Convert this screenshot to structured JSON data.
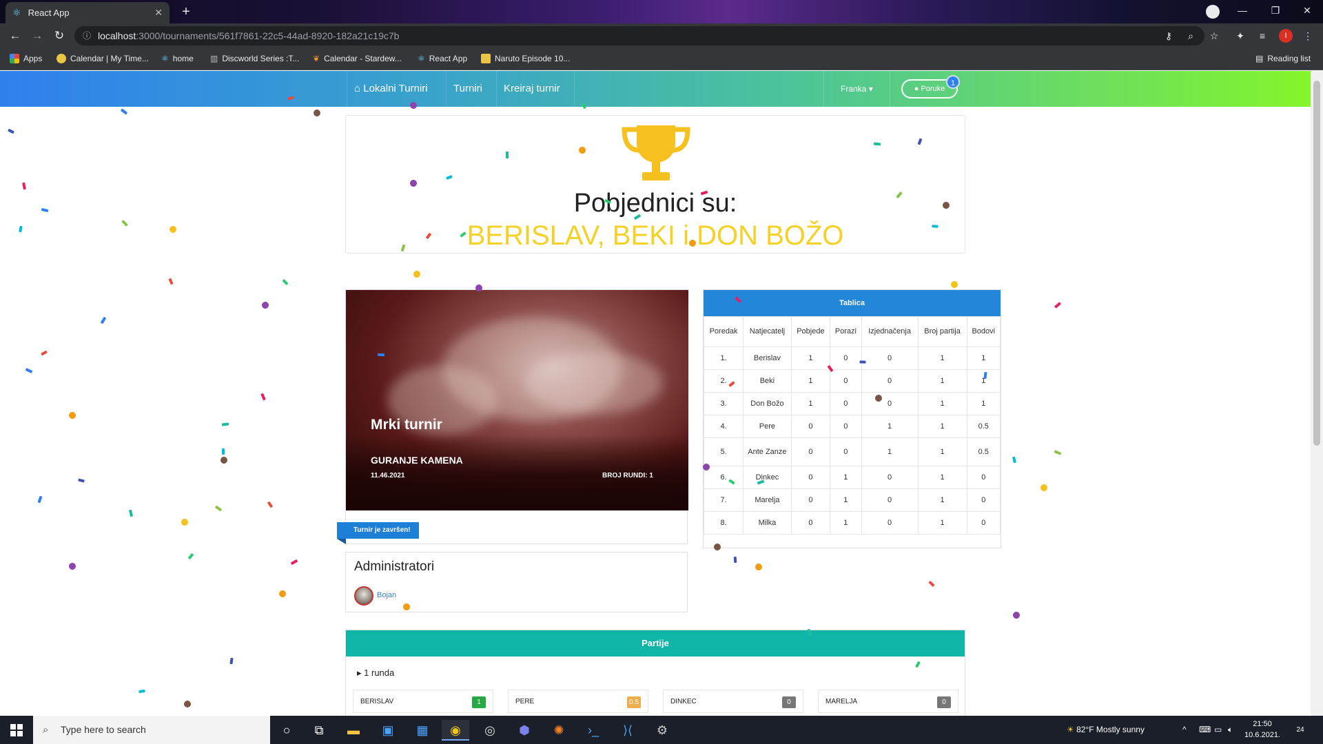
{
  "browser": {
    "tab_title": "React App",
    "new_tab": "+",
    "url_host": "localhost",
    "url_path": ":3000/tournaments/561f7861-22c5-44ad-8920-182a21c19c7b",
    "profile_initial": "I",
    "bookmarks": [
      {
        "label": "Apps",
        "icon": "apps-grid-icon",
        "color": "#ea4335"
      },
      {
        "label": "Calendar | My Time...",
        "icon": "calendar-icon",
        "color": "#e8c547"
      },
      {
        "label": "home",
        "icon": "react-icon",
        "color": "#61dafb"
      },
      {
        "label": "Discworld Series :T...",
        "icon": "book-icon",
        "color": "#bbbbbb"
      },
      {
        "label": "Calendar - Stardew...",
        "icon": "leaf-icon",
        "color": "#f09330"
      },
      {
        "label": "React App",
        "icon": "react-icon",
        "color": "#61dafb"
      },
      {
        "label": "Naruto Episode 10...",
        "icon": "film-icon",
        "color": "#e8c547"
      }
    ],
    "reading_list": "Reading list"
  },
  "navbar": {
    "home_link": "Lokalni Turniri",
    "tournaments_link": "Turniri",
    "create_link": "Kreiraj turnir",
    "user_name": "Franka",
    "messages_label": "Poruke",
    "messages_count": "1"
  },
  "winners": {
    "title": "Pobjednici su:",
    "names": "BERISLAV, BEKI i DON BOŽO"
  },
  "tournament": {
    "name": "Mrki turnir",
    "game": "GURANJE KAMENA",
    "date": "11.46.2021",
    "rounds": "BROJ RUNDI: 1",
    "status": "Turnir je završen!"
  },
  "admins": {
    "title": "Administratori",
    "names": [
      "Bojan"
    ]
  },
  "standings": {
    "title": "Tablica",
    "columns": [
      "Poredak",
      "Natjecatelj",
      "Pobjede",
      "Porazi",
      "Izjednačenja",
      "Broj partija",
      "Bodovi"
    ],
    "rows": [
      [
        "1.",
        "Berislav",
        "1",
        "0",
        "0",
        "1",
        "1"
      ],
      [
        "2.",
        "Beki",
        "1",
        "0",
        "0",
        "1",
        "1"
      ],
      [
        "3.",
        "Don Božo",
        "1",
        "0",
        "0",
        "1",
        "1"
      ],
      [
        "4.",
        "Pere",
        "0",
        "0",
        "1",
        "1",
        "0.5"
      ],
      [
        "5.",
        "Ante Zanze",
        "0",
        "0",
        "1",
        "1",
        "0.5"
      ],
      [
        "6.",
        "Dinkec",
        "0",
        "1",
        "0",
        "1",
        "0"
      ],
      [
        "7.",
        "Marelja",
        "0",
        "1",
        "0",
        "1",
        "0"
      ],
      [
        "8.",
        "Milka",
        "0",
        "1",
        "0",
        "1",
        "0"
      ]
    ]
  },
  "games": {
    "title": "Partije",
    "round_label": "1 runda",
    "matches": [
      {
        "name": "BERISLAV",
        "score": "1",
        "color": "#28a745"
      },
      {
        "name": "PERE",
        "score": "0.5",
        "color": "#f0ad4e"
      },
      {
        "name": "DINKEC",
        "score": "0",
        "color": "#777777"
      },
      {
        "name": "MARELJA",
        "score": "0",
        "color": "#777777"
      }
    ]
  },
  "taskbar": {
    "search_placeholder": "Type here to search",
    "weather": "82°F  Mostly sunny",
    "time": "21:50",
    "date": "10.6.2021.",
    "notifications": "24"
  },
  "colors": {
    "winner_gold": "#f6d125",
    "table_header": "#2387d9",
    "games_header": "#0fb5a6",
    "finished_ribbon": "#1e7fd6"
  }
}
